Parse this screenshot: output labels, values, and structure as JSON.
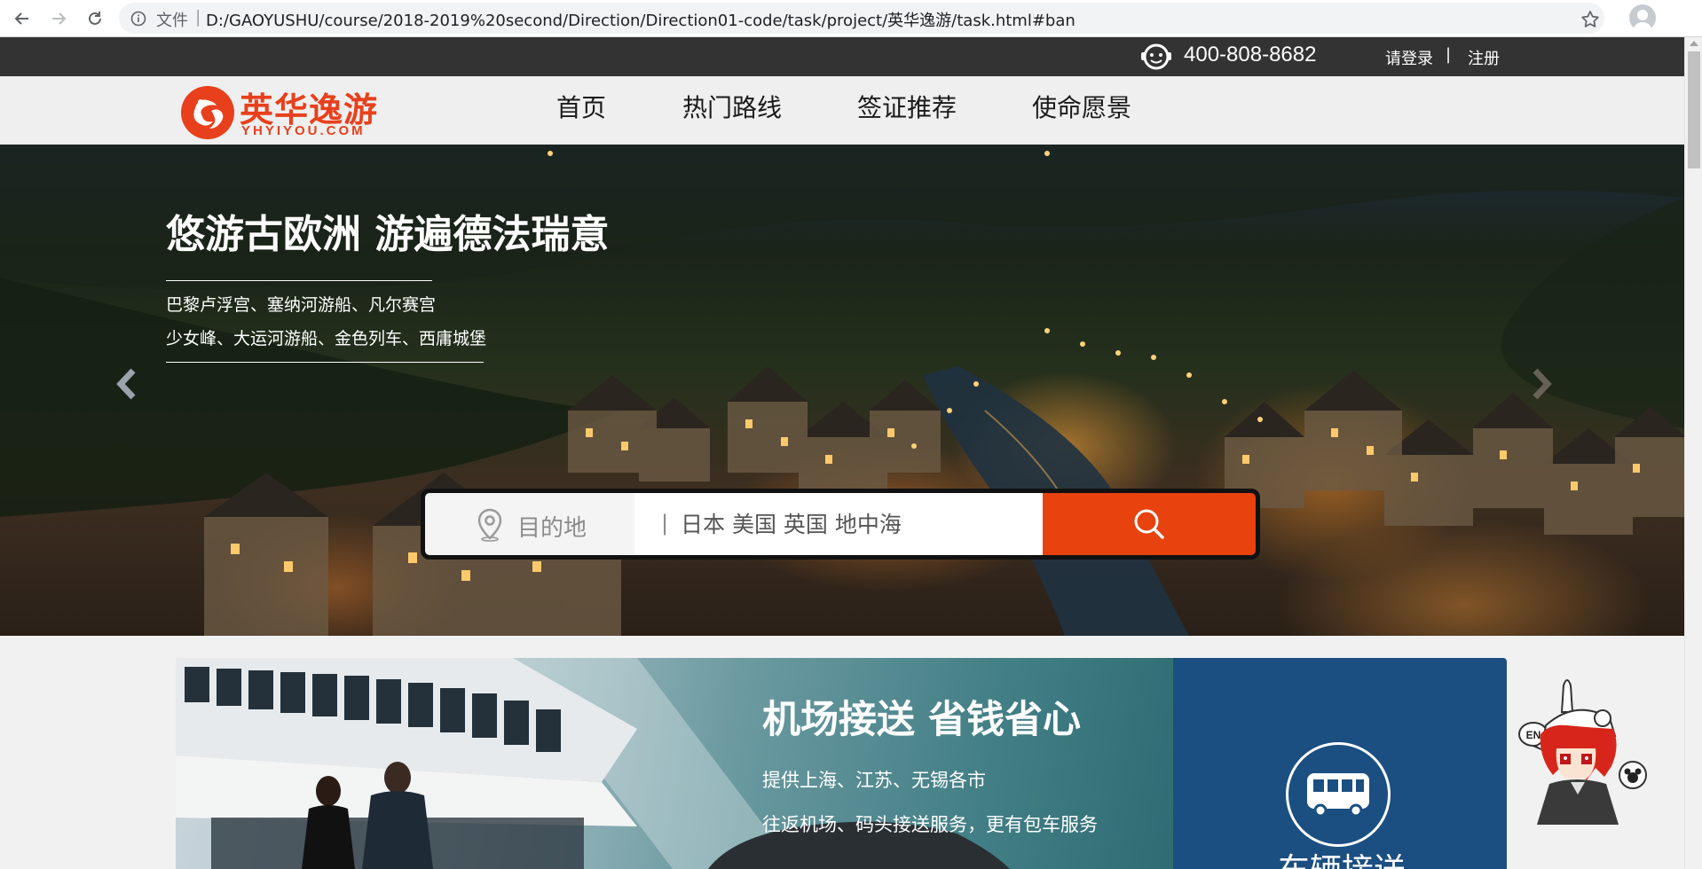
{
  "browser": {
    "scheme_label": "文件",
    "url": "D:/GAOYUSHU/course/2018-2019%20second/Direction/Direction01-code/task/project/英华逸游/task.html#ban"
  },
  "topbar": {
    "phone": "400-808-8682",
    "login": "请登录",
    "separator": "|",
    "register": "注册"
  },
  "header": {
    "logo_name": "英华逸游",
    "logo_domain": "YHYIYOU.COM",
    "nav": [
      {
        "label": "首页"
      },
      {
        "label": "热门路线"
      },
      {
        "label": "签证推荐"
      },
      {
        "label": "使命愿景"
      }
    ]
  },
  "hero": {
    "title": "悠游古欧洲 游遍德法瑞意",
    "sub1": "巴黎卢浮宫、塞纳河游船、凡尔赛宫",
    "sub2": "少女峰、大运河游船、金色列车、西庸城堡"
  },
  "search": {
    "dest_label": "目的地",
    "input_prefix": "|",
    "placeholder": "日本 美国 英国 地中海"
  },
  "service": {
    "title": "机场接送 省钱省心",
    "line1": "提供上海、江苏、无锡各市",
    "line2": "往返机场、码头接送服务，更有包车服务",
    "side_label": "车辆接送"
  },
  "mascot": {
    "badge": "EN"
  },
  "colors": {
    "brand": "#e8401c",
    "search_button": "#e8420e",
    "topbar": "#333333",
    "service_side": "#1b4f82"
  }
}
